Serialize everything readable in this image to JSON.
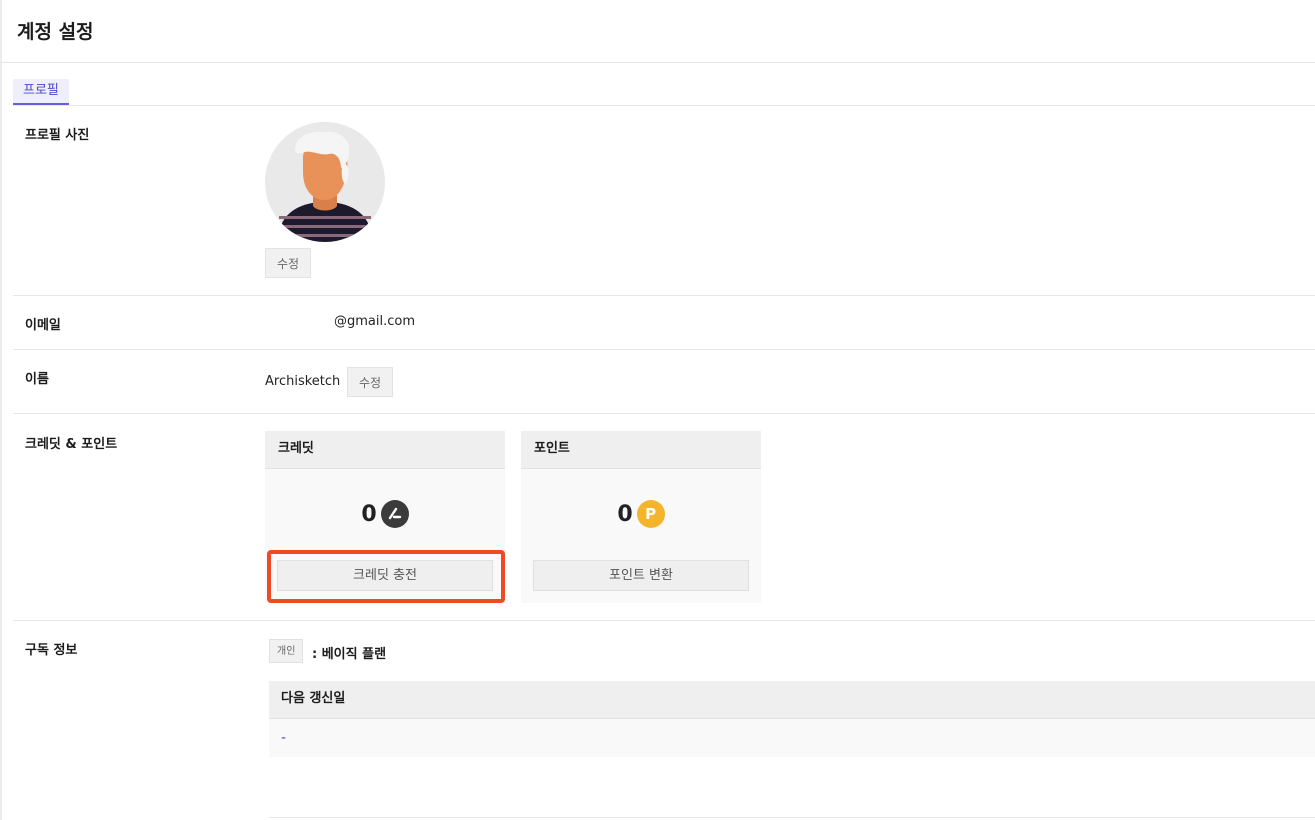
{
  "page": {
    "title": "계정 설정"
  },
  "tabs": [
    {
      "label": "프로필"
    }
  ],
  "profile_photo": {
    "label": "프로필 사진",
    "edit_label": "수정"
  },
  "email": {
    "label": "이메일",
    "value": "@gmail.com"
  },
  "name": {
    "label": "이름",
    "value": "Archisketch",
    "edit_label": "수정"
  },
  "credits_points": {
    "label": "크레딧 & 포인트",
    "credit_card": {
      "title": "크레딧",
      "amount": "0",
      "icon": "credit-coin-icon",
      "button_label": "크레딧 충전"
    },
    "point_card": {
      "title": "포인트",
      "amount": "0",
      "icon_glyph": "P",
      "button_label": "포인트 변환"
    }
  },
  "subscription": {
    "label": "구독 정보",
    "badge": "개인",
    "plan_text": ": 베이직 플랜",
    "table": {
      "header": "다음 갱신일",
      "value": "-"
    }
  },
  "colors": {
    "accent": "#6560e0",
    "highlight": "#f04a23",
    "point_coin": "#f4b52b",
    "credit_coin": "#3b3b3b"
  }
}
